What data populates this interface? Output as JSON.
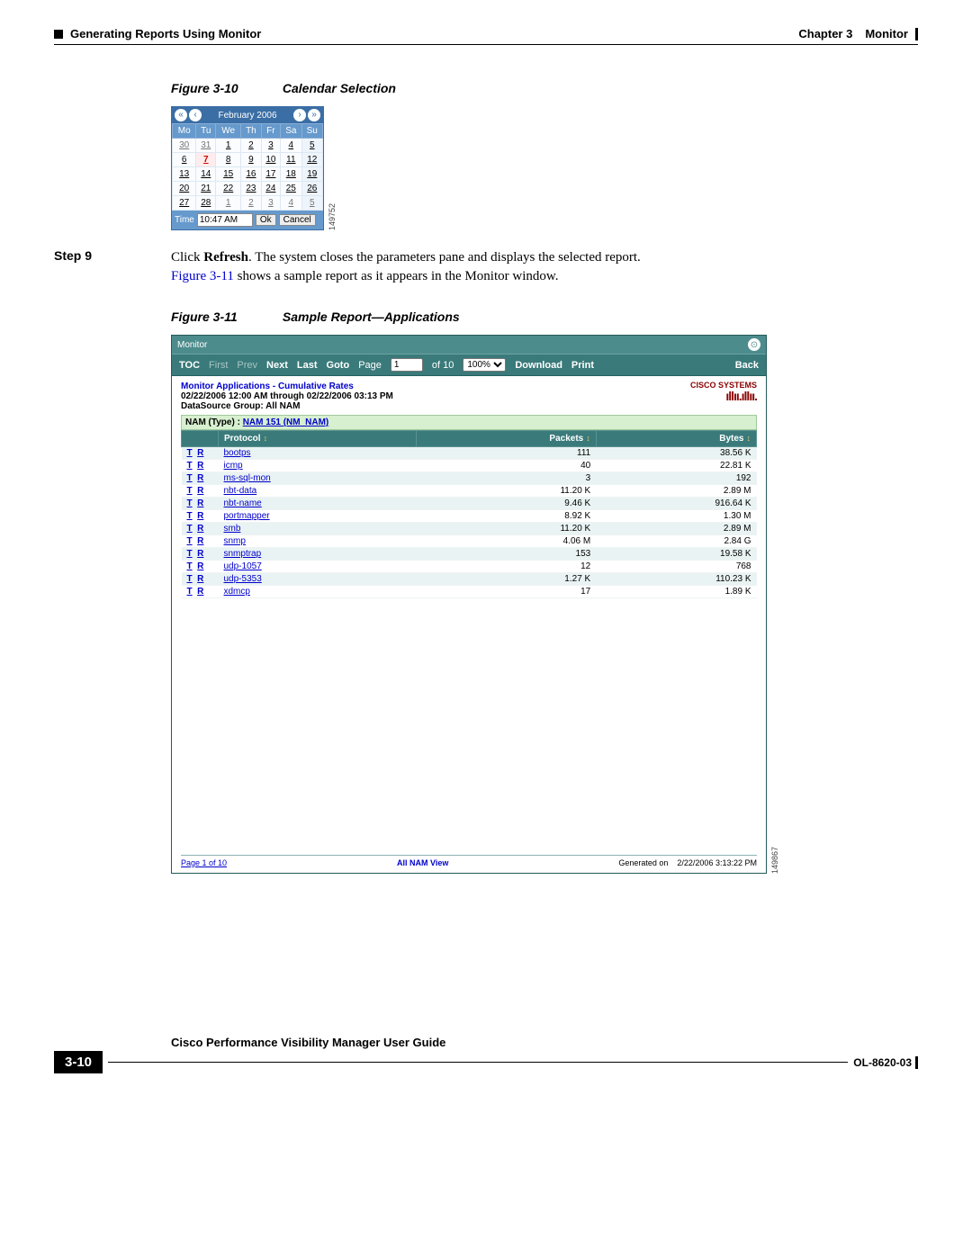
{
  "header": {
    "left": "Generating Reports Using Monitor",
    "right_chapter": "Chapter 3",
    "right_title": "Monitor"
  },
  "figure10": {
    "num": "Figure 3-10",
    "title": "Calendar Selection",
    "side_id": "149752"
  },
  "calendar": {
    "month": "February 2006",
    "dow": [
      "Mo",
      "Tu",
      "We",
      "Th",
      "Fr",
      "Sa",
      "Su"
    ],
    "rows": [
      [
        "30",
        "31",
        "1",
        "2",
        "3",
        "4",
        "5"
      ],
      [
        "6",
        "7",
        "8",
        "9",
        "10",
        "11",
        "12"
      ],
      [
        "13",
        "14",
        "15",
        "16",
        "17",
        "18",
        "19"
      ],
      [
        "20",
        "21",
        "22",
        "23",
        "24",
        "25",
        "26"
      ],
      [
        "27",
        "28",
        "1",
        "2",
        "3",
        "4",
        "5"
      ]
    ],
    "time_label": "Time",
    "time_value": "10:47 AM",
    "ok": "Ok",
    "cancel": "Cancel"
  },
  "step9": {
    "label": "Step 9",
    "pre": "Click ",
    "bold": "Refresh",
    "post": ". The system closes the parameters pane and displays the selected report.",
    "line2a": "Figure 3-11",
    "line2b": " shows a sample report as it appears in the Monitor window."
  },
  "figure11": {
    "num": "Figure 3-11",
    "title": "Sample Report—Applications",
    "side_id": "149867"
  },
  "report": {
    "titlebar": "Monitor",
    "toolbar": {
      "toc": "TOC",
      "first": "First",
      "prev": "Prev",
      "next": "Next",
      "last": "Last",
      "goto": "Goto",
      "page": "Page",
      "page_val": "1",
      "of": "of 10",
      "zoom_val": "100%",
      "download": "Download",
      "print": "Print",
      "back": "Back"
    },
    "header": {
      "line1": "Monitor Applications - Cumulative Rates",
      "line2": "02/22/2006 12:00 AM through 02/22/2006 03:13 PM",
      "line3": "DataSource Group:  All NAM",
      "cisco": "CISCO SYSTEMS"
    },
    "nam_row_label": "NAM (Type) : ",
    "nam_row_link": "NAM 151 (NM_NAM)",
    "columns": {
      "protocol": "Protocol",
      "packets": "Packets",
      "bytes": "Bytes"
    },
    "rows": [
      {
        "proto": "bootps",
        "packets": "111",
        "bytes": "38.56 K"
      },
      {
        "proto": "icmp",
        "packets": "40",
        "bytes": "22.81 K"
      },
      {
        "proto": "ms-sql-mon",
        "packets": "3",
        "bytes": "192"
      },
      {
        "proto": "nbt-data",
        "packets": "11.20 K",
        "bytes": "2.89 M"
      },
      {
        "proto": "nbt-name",
        "packets": "9.46 K",
        "bytes": "916.64 K"
      },
      {
        "proto": "portmapper",
        "packets": "8.92 K",
        "bytes": "1.30 M"
      },
      {
        "proto": "smb",
        "packets": "11.20 K",
        "bytes": "2.89 M"
      },
      {
        "proto": "snmp",
        "packets": "4.06 M",
        "bytes": "2.84 G"
      },
      {
        "proto": "snmptrap",
        "packets": "153",
        "bytes": "19.58 K"
      },
      {
        "proto": "udp-1057",
        "packets": "12",
        "bytes": "768"
      },
      {
        "proto": "udp-5353",
        "packets": "1.27 K",
        "bytes": "110.23 K"
      },
      {
        "proto": "xdmcp",
        "packets": "17",
        "bytes": "1.89 K"
      }
    ],
    "footer": {
      "page": "Page 1 of 10",
      "center": "All NAM View",
      "gen_label": "Generated on",
      "gen_time": "2/22/2006 3:13:22 PM"
    }
  },
  "page_footer": {
    "guide": "Cisco Performance Visibility Manager User Guide",
    "page_num": "3-10",
    "doc_id": "OL-8620-03"
  }
}
